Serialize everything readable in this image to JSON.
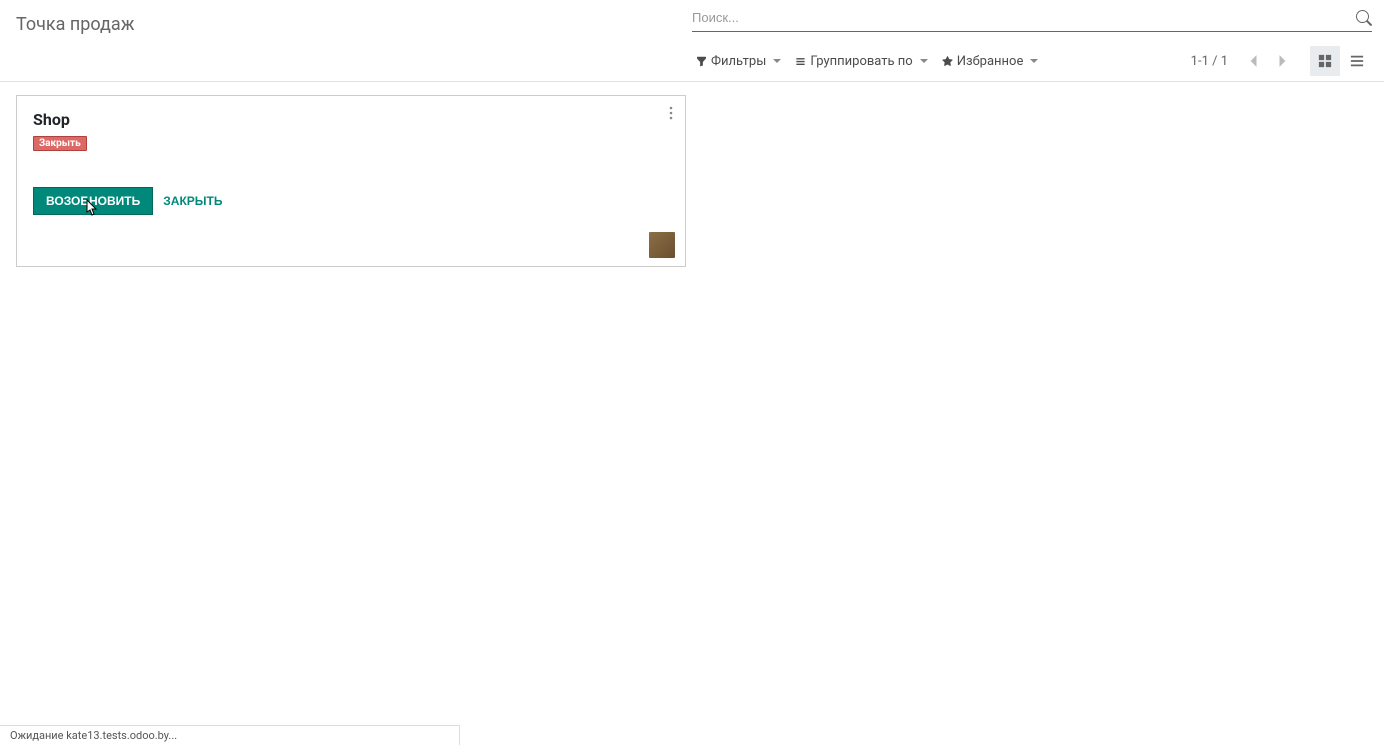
{
  "page": {
    "title": "Точка продаж"
  },
  "search": {
    "placeholder": "Поиск..."
  },
  "toolbar": {
    "filters_label": "Фильтры",
    "group_by_label": "Группировать по",
    "favorites_label": "Избранное"
  },
  "pagination": {
    "indicator": "1-1 / 1"
  },
  "card": {
    "title": "Shop",
    "status": "Закрыть",
    "resume_label": "ВОЗОБНОВИТЬ",
    "close_label": "ЗАКРЫТЬ"
  },
  "status_bar": {
    "text": "Ожидание kate13.tests.odoo.by..."
  }
}
